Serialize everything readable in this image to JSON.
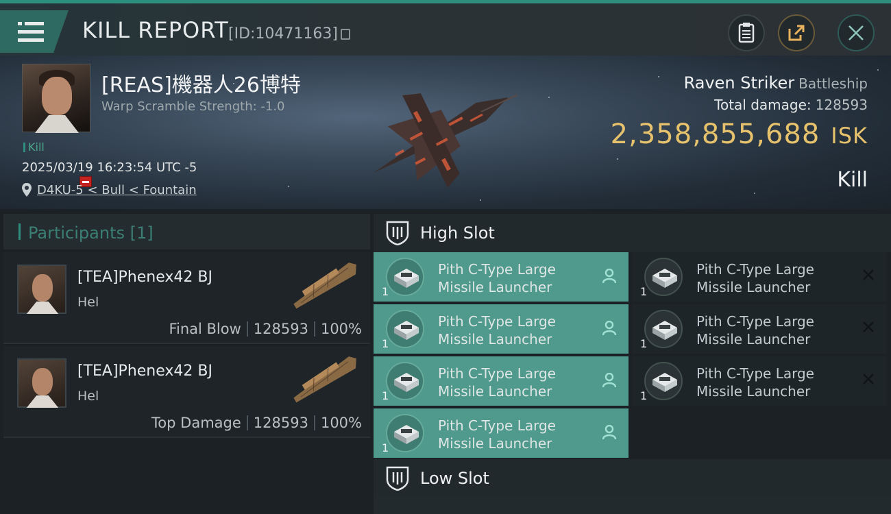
{
  "header": {
    "title": "KILL REPORT",
    "report_id": "[ID:10471163]"
  },
  "victim": {
    "name": "[REAS]機器人26博特",
    "warp_scramble": "Warp Scramble Strength: -1.0",
    "kill_tag": "Kill",
    "date": "2025/03/19 16:23:54 UTC -5",
    "location": "D4KU-5 < Bull < Fountain",
    "ship_name": "Raven Striker",
    "ship_class": "Battleship",
    "total_damage_label": "Total damage:",
    "total_damage_value": "128593",
    "isk_value": "2,358,855,688",
    "isk_unit": "ISK",
    "result": "Kill"
  },
  "participants": {
    "label": "Participants [1]",
    "rows": [
      {
        "name": "[TEA]Phenex42 BJ",
        "ship": "Hel",
        "role": "Final Blow",
        "damage": "128593",
        "percent": "100%"
      },
      {
        "name": "[TEA]Phenex42 BJ",
        "ship": "Hel",
        "role": "Top Damage",
        "damage": "128593",
        "percent": "100%"
      }
    ]
  },
  "high_slot": {
    "label": "High Slot",
    "modules": [
      {
        "line1": "Pith C-Type Large",
        "line2": "Missile Launcher",
        "qty": "1",
        "state": "fitted"
      },
      {
        "line1": "Pith C-Type Large",
        "line2": "Missile Launcher",
        "qty": "1",
        "state": "destroyed"
      },
      {
        "line1": "Pith C-Type Large",
        "line2": "Missile Launcher",
        "qty": "1",
        "state": "fitted"
      },
      {
        "line1": "Pith C-Type Large",
        "line2": "Missile Launcher",
        "qty": "1",
        "state": "destroyed"
      },
      {
        "line1": "Pith C-Type Large",
        "line2": "Missile Launcher",
        "qty": "1",
        "state": "fitted"
      },
      {
        "line1": "Pith C-Type Large",
        "line2": "Missile Launcher",
        "qty": "1",
        "state": "destroyed"
      },
      {
        "line1": "Pith C-Type Large",
        "line2": "Missile Launcher",
        "qty": "1",
        "state": "fitted"
      }
    ]
  },
  "low_slot": {
    "label": "Low Slot"
  },
  "colors": {
    "accent": "#2f8f7e",
    "isk": "#e7c26d",
    "module_fitted": "#4f9a8c",
    "badge_red": "#c4241f"
  },
  "icons": [
    "menu-icon",
    "clipboard-icon",
    "share-icon",
    "close-icon",
    "location-pin-icon",
    "shield-slot-icon",
    "pilot-icon",
    "destroyed-x-icon"
  ]
}
